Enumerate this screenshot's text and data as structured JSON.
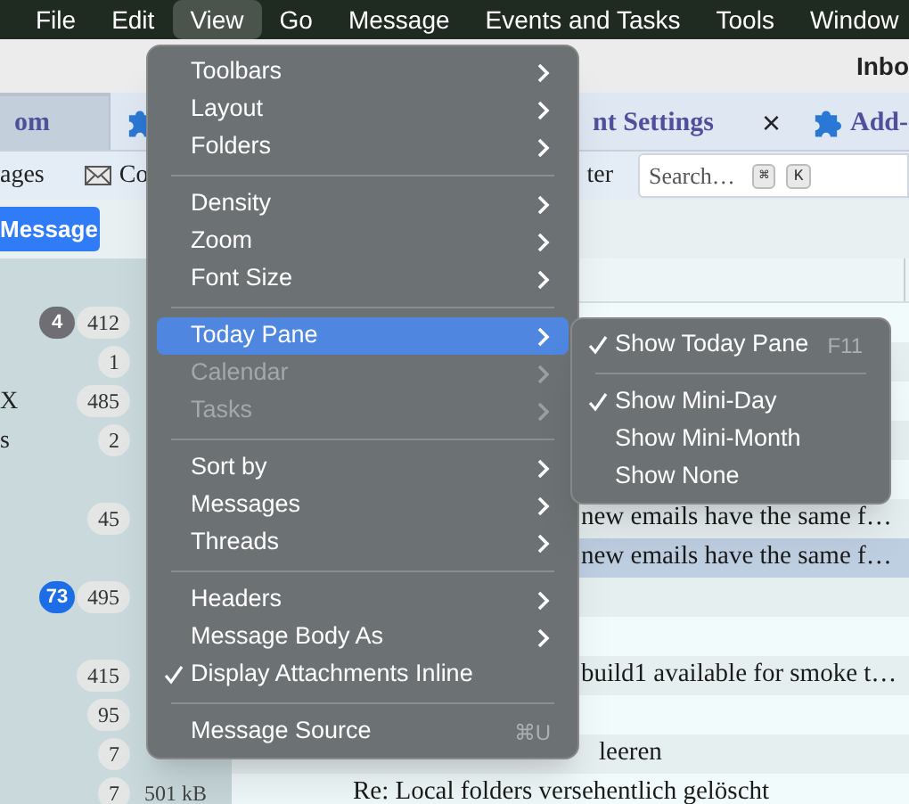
{
  "menu_bar": [
    {
      "label": "File",
      "selected": false
    },
    {
      "label": "Edit",
      "selected": false
    },
    {
      "label": "View",
      "selected": true
    },
    {
      "label": "Go",
      "selected": false
    },
    {
      "label": "Message",
      "selected": false
    },
    {
      "label": "Events and Tasks",
      "selected": false
    },
    {
      "label": "Tools",
      "selected": false
    },
    {
      "label": "Window",
      "selected": false
    }
  ],
  "window": {
    "title": "Inbo"
  },
  "tabs": [
    {
      "kind": "page",
      "label": "om",
      "selected": true
    },
    {
      "kind": "addon",
      "selected": false
    },
    {
      "kind": "page",
      "label": "nt Settings",
      "close": "×",
      "selected": false
    },
    {
      "kind": "addon",
      "label": "Add-",
      "selected": false
    }
  ],
  "toolbar": {
    "left_label": "ages",
    "compose_label": "Co",
    "filter_label": "ter",
    "search": {
      "placeholder": "Search…",
      "keys": [
        "⌘",
        "K"
      ]
    }
  },
  "new_message_button": "Message",
  "rows": [
    {
      "folder": {
        "unread": "4",
        "color": "#6e6e73",
        "total": "412"
      },
      "selected": false
    },
    {
      "folder": {
        "total": "1"
      },
      "selected": false
    },
    {
      "folder": {
        "name": "X",
        "total": "485"
      },
      "selected": false
    },
    {
      "folder": {
        "name": "s",
        "total": "2"
      },
      "selected": false
    },
    {
      "selected": false
    },
    {
      "folder": {
        "total": "45"
      },
      "subject": "new emails have the same f…",
      "selected": false
    },
    {
      "subject": "new emails have the same f…",
      "selected": true
    },
    {
      "folder": {
        "unread": "73",
        "color": "#1d6ee6",
        "total": "495"
      },
      "selected": false
    },
    {
      "selected": false
    },
    {
      "folder": {
        "total": "415"
      },
      "subject": "build1 available for smoke t…",
      "selected": false
    },
    {
      "folder": {
        "total": "95"
      },
      "selected": false
    },
    {
      "folder": {
        "total": "7"
      },
      "subject": "leeren",
      "selected": false
    },
    {
      "folder": {
        "total": "7",
        "size": "501 kB"
      },
      "subject": "Re: Local folders versehentlich gelöscht",
      "selected": false
    }
  ],
  "view_menu": [
    {
      "kind": "item",
      "label": "Toolbars",
      "submenu": true
    },
    {
      "kind": "item",
      "label": "Layout",
      "submenu": true
    },
    {
      "kind": "item",
      "label": "Folders",
      "submenu": true
    },
    {
      "kind": "separator"
    },
    {
      "kind": "item",
      "label": "Density",
      "submenu": true
    },
    {
      "kind": "item",
      "label": "Zoom",
      "submenu": true
    },
    {
      "kind": "item",
      "label": "Font Size",
      "submenu": true
    },
    {
      "kind": "separator"
    },
    {
      "kind": "item",
      "label": "Today Pane",
      "submenu": true,
      "selected": true
    },
    {
      "kind": "item",
      "label": "Calendar",
      "submenu": true,
      "disabled": true
    },
    {
      "kind": "item",
      "label": "Tasks",
      "submenu": true,
      "disabled": true
    },
    {
      "kind": "separator"
    },
    {
      "kind": "item",
      "label": "Sort by",
      "submenu": true
    },
    {
      "kind": "item",
      "label": "Messages",
      "submenu": true
    },
    {
      "kind": "item",
      "label": "Threads",
      "submenu": true
    },
    {
      "kind": "separator"
    },
    {
      "kind": "item",
      "label": "Headers",
      "submenu": true
    },
    {
      "kind": "item",
      "label": "Message Body As",
      "submenu": true
    },
    {
      "kind": "item",
      "label": "Display Attachments Inline",
      "checked": true
    },
    {
      "kind": "separator"
    },
    {
      "kind": "item",
      "label": "Message Source",
      "shortcut": "⌘U"
    }
  ],
  "today_pane_submenu": [
    {
      "kind": "item",
      "label": "Show Today Pane",
      "checked": true,
      "shortcut": "F11"
    },
    {
      "kind": "separator"
    },
    {
      "kind": "item",
      "label": "Show Mini-Day",
      "checked": true
    },
    {
      "kind": "item",
      "label": "Show Mini-Month",
      "checked": false
    },
    {
      "kind": "item",
      "label": "Show None",
      "checked": false
    }
  ]
}
